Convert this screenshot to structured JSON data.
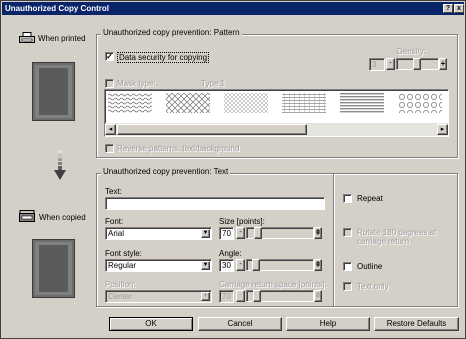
{
  "window": {
    "title": "Unauthorized Copy Control",
    "help": "?",
    "close": "x"
  },
  "left": {
    "when_printed": "When printed",
    "when_copied": "When copied"
  },
  "pattern_group": {
    "title": "Unauthorized copy prevention: Pattern",
    "data_security_label": "Data security for copying",
    "data_security_checked": "✓",
    "density_label": "Density:",
    "density_value": "3",
    "mask_type_label": "Mask type:",
    "mask_type_value": "Type 1",
    "reverse_label": "Reverse patterns: text/background"
  },
  "text_group": {
    "title": "Unauthorized copy prevention: Text",
    "text_label": "Text:",
    "text_value": "",
    "font_label": "Font:",
    "font_value": "Arial",
    "size_label": "Size [points]:",
    "size_value": "70",
    "style_label": "Font style:",
    "style_value": "Regular",
    "angle_label": "Angle:",
    "angle_value": "30",
    "position_label": "Position:",
    "position_value": "Center",
    "carriage_label": "Carriage return space [points]:",
    "carriage_value": "70",
    "repeat_label": "Repeat",
    "rotate_label": "Rotate 180 degrees at carriage return",
    "outline_label": "Outline",
    "text_only_label": "Text only"
  },
  "buttons": {
    "ok": "OK",
    "cancel": "Cancel",
    "help": "Help",
    "restore": "Restore Defaults"
  }
}
